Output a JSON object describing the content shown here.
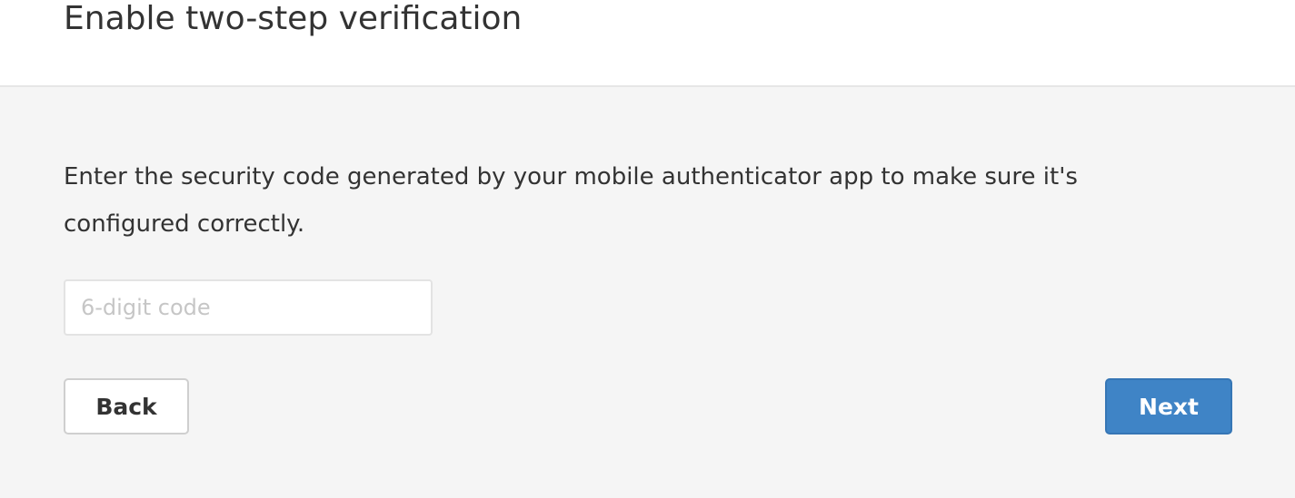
{
  "header": {
    "title": "Enable two-step verification"
  },
  "main": {
    "instructions": "Enter the security code generated by your mobile authenticator app to make sure it's configured correctly.",
    "code_input": {
      "value": "",
      "placeholder": "6-digit code"
    },
    "back_label": "Back",
    "next_label": "Next"
  },
  "colors": {
    "accent": "#3f84c6",
    "body_background": "#f5f5f5",
    "text": "#333333"
  }
}
